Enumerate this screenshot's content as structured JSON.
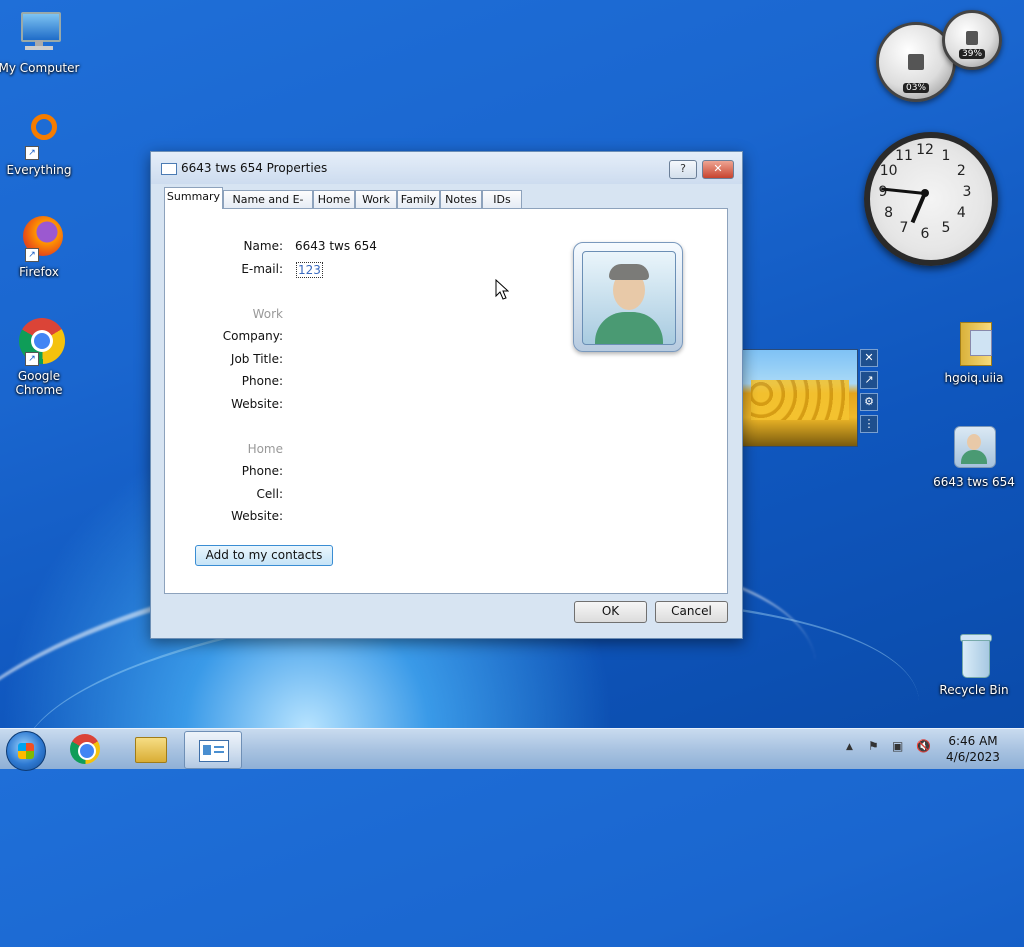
{
  "desktop": {
    "icons": [
      {
        "label": "My Computer"
      },
      {
        "label": "Everything"
      },
      {
        "label": "Firefox"
      },
      {
        "label": "Google Chrome"
      },
      {
        "label": "hgoiq.uiia"
      },
      {
        "label": "6643 tws 654"
      },
      {
        "label": "Recycle Bin"
      }
    ],
    "gadgets": {
      "cpu_meter": {
        "cpu_percent": "03%",
        "memory_percent": "39%"
      },
      "clock": {
        "numbers": [
          "12",
          "1",
          "2",
          "3",
          "4",
          "5",
          "6",
          "7",
          "8",
          "9",
          "10",
          "11"
        ],
        "time": "6:46"
      }
    }
  },
  "dialog": {
    "title": "6643 tws 654 Properties",
    "help_label": "?",
    "close_label": "✕",
    "tabs": [
      "Summary",
      "Name and E-mail",
      "Home",
      "Work",
      "Family",
      "Notes",
      "IDs"
    ],
    "active_tab": "Summary",
    "summary": {
      "name_label": "Name:",
      "name_value": "6643 tws 654",
      "email_label": "E-mail:",
      "email_value": "123",
      "work_heading": "Work",
      "company_label": "Company:",
      "job_title_label": "Job Title:",
      "work_phone_label": "Phone:",
      "work_website_label": "Website:",
      "home_heading": "Home",
      "home_phone_label": "Phone:",
      "cell_label": "Cell:",
      "home_website_label": "Website:",
      "add_button": "Add to my contacts"
    },
    "ok_label": "OK",
    "cancel_label": "Cancel"
  },
  "taskbar": {
    "tray_time": "6:46 AM",
    "tray_date": "4/6/2023",
    "tray_arrow": "▲"
  }
}
